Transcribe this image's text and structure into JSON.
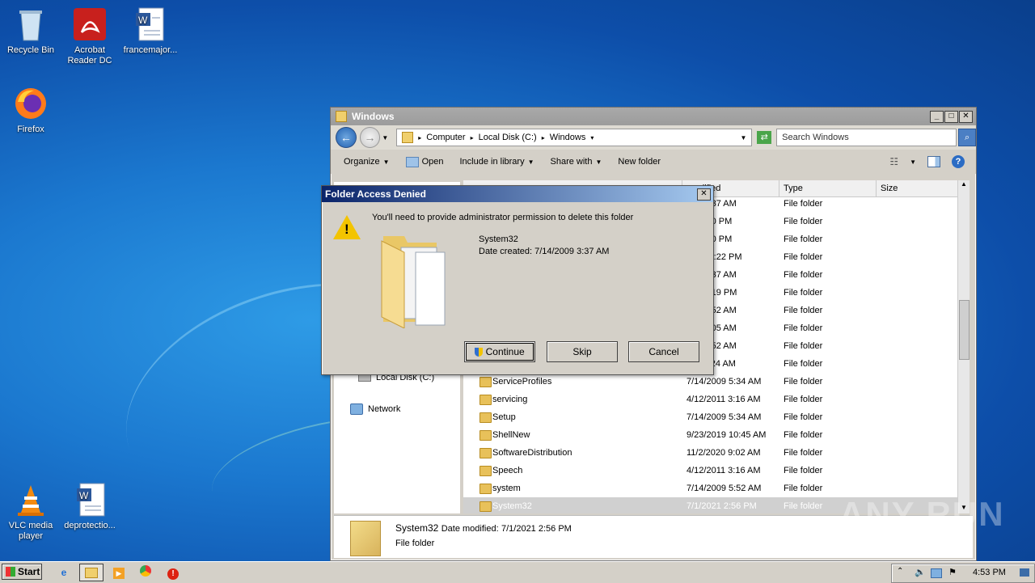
{
  "desktop": {
    "icons": [
      {
        "label": "Recycle Bin"
      },
      {
        "label": "Acrobat Reader DC"
      },
      {
        "label": "francemajor..."
      },
      {
        "label": "Firefox"
      },
      {
        "label": "VLC media player"
      },
      {
        "label": "deprotectio..."
      }
    ]
  },
  "explorer": {
    "title": "Windows",
    "breadcrumb": [
      "Computer",
      "Local Disk (C:)",
      "Windows"
    ],
    "search_placeholder": "Search Windows",
    "toolbar": {
      "organize": "Organize",
      "open": "Open",
      "include": "Include in library",
      "share": "Share with",
      "new_folder": "New folder"
    },
    "columns": {
      "modified": "odified",
      "type": "Type",
      "size": "Size"
    },
    "nav": {
      "local_disk": "Local Disk (C:)",
      "network": "Network"
    },
    "rows": [
      {
        "name": "",
        "date": "009 3:37 AM",
        "type": "File folder"
      },
      {
        "name": "",
        "date": "21 2:30 PM",
        "type": "File folder"
      },
      {
        "name": "",
        "date": "18 1:20 PM",
        "type": "File folder"
      },
      {
        "name": "",
        "date": "018 12:22 PM",
        "type": "File folder"
      },
      {
        "name": "",
        "date": "009 3:37 AM",
        "type": "File folder"
      },
      {
        "name": "",
        "date": "017 6:19 PM",
        "type": "File folder"
      },
      {
        "name": "",
        "date": "009 5:52 AM",
        "type": "File folder"
      },
      {
        "name": "",
        "date": "009 3:05 AM",
        "type": "File folder"
      },
      {
        "name": "",
        "date": "009 5:52 AM",
        "type": "File folder"
      },
      {
        "name": "",
        "date": "011 3:24 AM",
        "type": "File folder"
      },
      {
        "name": "ServiceProfiles",
        "date": "7/14/2009 5:34 AM",
        "type": "File folder"
      },
      {
        "name": "servicing",
        "date": "4/12/2011 3:16 AM",
        "type": "File folder"
      },
      {
        "name": "Setup",
        "date": "7/14/2009 5:34 AM",
        "type": "File folder"
      },
      {
        "name": "ShellNew",
        "date": "9/23/2019 10:45 AM",
        "type": "File folder"
      },
      {
        "name": "SoftwareDistribution",
        "date": "11/2/2020 9:02 AM",
        "type": "File folder"
      },
      {
        "name": "Speech",
        "date": "4/12/2011 3:16 AM",
        "type": "File folder"
      },
      {
        "name": "system",
        "date": "7/14/2009 5:52 AM",
        "type": "File folder"
      },
      {
        "name": "System32",
        "date": "7/1/2021 2:56 PM",
        "type": "File folder"
      }
    ],
    "details": {
      "name": "System32",
      "modified_label": "Date modified:",
      "modified_value": "7/1/2021 2:56 PM",
      "type": "File folder"
    }
  },
  "dialog": {
    "title": "Folder Access Denied",
    "message": "You'll need to provide administrator permission to delete this folder",
    "folder_name": "System32",
    "date_created": "Date created: 7/14/2009 3:37 AM",
    "buttons": {
      "continue": "Continue",
      "skip": "Skip",
      "cancel": "Cancel"
    }
  },
  "taskbar": {
    "start": "Start",
    "clock": "4:53 PM"
  },
  "watermark": "ANY RUN"
}
